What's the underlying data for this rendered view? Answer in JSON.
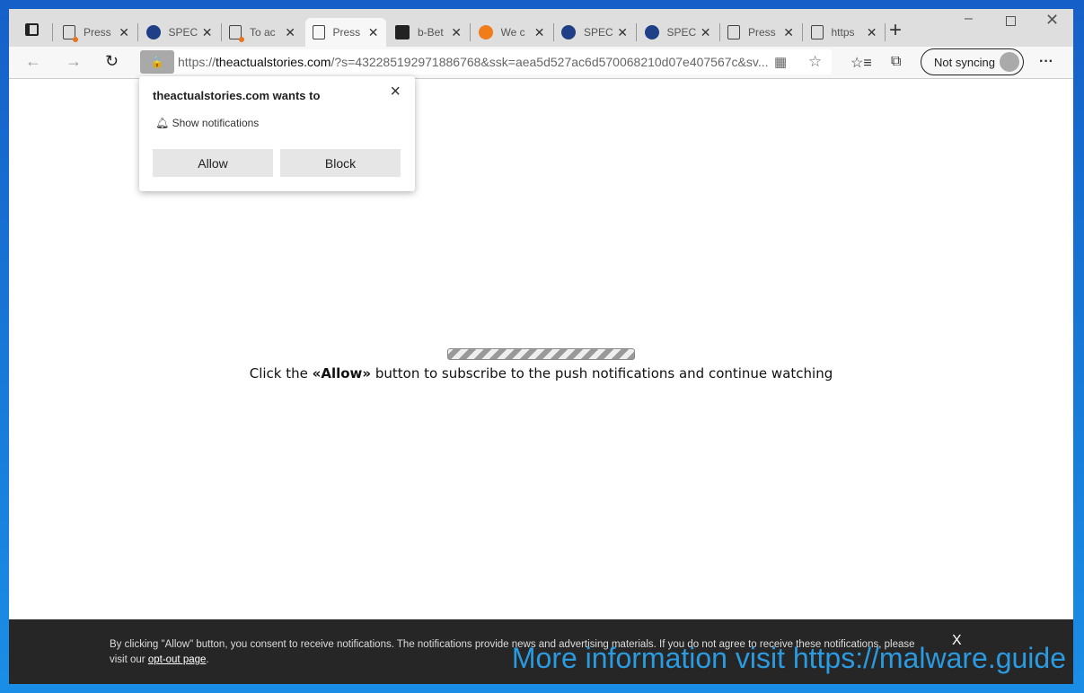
{
  "tabs": [
    {
      "title": "Press",
      "icon": "page-icon-notify"
    },
    {
      "title": "SPEC",
      "icon": "nyt-icon"
    },
    {
      "title": "To ac",
      "icon": "page-icon-notify"
    },
    {
      "title": "Press",
      "icon": "page-icon",
      "active": true
    },
    {
      "title": "b-Bet",
      "icon": "dark-logo-icon"
    },
    {
      "title": "We c",
      "icon": "orange-chart-icon"
    },
    {
      "title": "SPEC",
      "icon": "nyt-icon"
    },
    {
      "title": "SPEC",
      "icon": "nyt-icon"
    },
    {
      "title": "Press",
      "icon": "page-icon"
    },
    {
      "title": "https",
      "icon": "page-icon"
    }
  ],
  "address": {
    "domain": "theactualstories.com",
    "prefix": "https://",
    "rest": "/?s=432285192971886768&ssk=aea5d527ac6d570068210d07e407567c&sv..."
  },
  "sync_label": "Not syncing",
  "popup": {
    "title": "theactualstories.com wants to",
    "permission": "Show notifications",
    "allow": "Allow",
    "block": "Block"
  },
  "page": {
    "msg_pre": "Click the ",
    "msg_bold": "«Allow»",
    "msg_post": " button to subscribe to the push notifications and continue watching",
    "progress_state": "indeterminate"
  },
  "banner": {
    "text": "By clicking \"Allow\" button, you consent to receive notifications. The notifications provide news and advertising materials. If you do not agree to receive these notifications, please visit our ",
    "link": "opt-out page",
    "end": ".",
    "close": "X"
  },
  "watermark": "More information visit https://malware.guide"
}
